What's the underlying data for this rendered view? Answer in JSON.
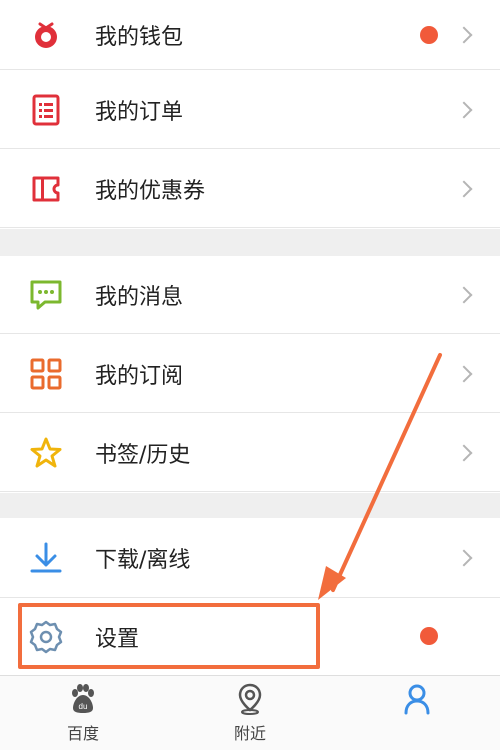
{
  "menu": {
    "group1": [
      {
        "label": "我的钱包",
        "icon": "wallet-icon",
        "has_dot": true
      },
      {
        "label": "我的订单",
        "icon": "order-list-icon",
        "has_dot": false
      },
      {
        "label": "我的优惠券",
        "icon": "coupon-icon",
        "has_dot": false
      }
    ],
    "group2": [
      {
        "label": "我的消息",
        "icon": "message-icon",
        "has_dot": false
      },
      {
        "label": "我的订阅",
        "icon": "subscription-grid-icon",
        "has_dot": false
      },
      {
        "label": "书签/历史",
        "icon": "star-icon",
        "has_dot": false
      }
    ],
    "group3": [
      {
        "label": "下载/离线",
        "icon": "download-icon",
        "has_dot": false
      },
      {
        "label": "设置",
        "icon": "gear-icon",
        "has_dot": true
      }
    ]
  },
  "tabbar": {
    "tabs": [
      {
        "label": "百度",
        "icon": "baidu-paw-icon"
      },
      {
        "label": "附近",
        "icon": "location-pin-icon"
      },
      {
        "label": "",
        "icon": "profile-icon"
      }
    ]
  },
  "colors": {
    "notification_dot": "#f15a3a",
    "highlight_annotation": "#f26d3d",
    "active_tab": "#3a8ee6"
  }
}
